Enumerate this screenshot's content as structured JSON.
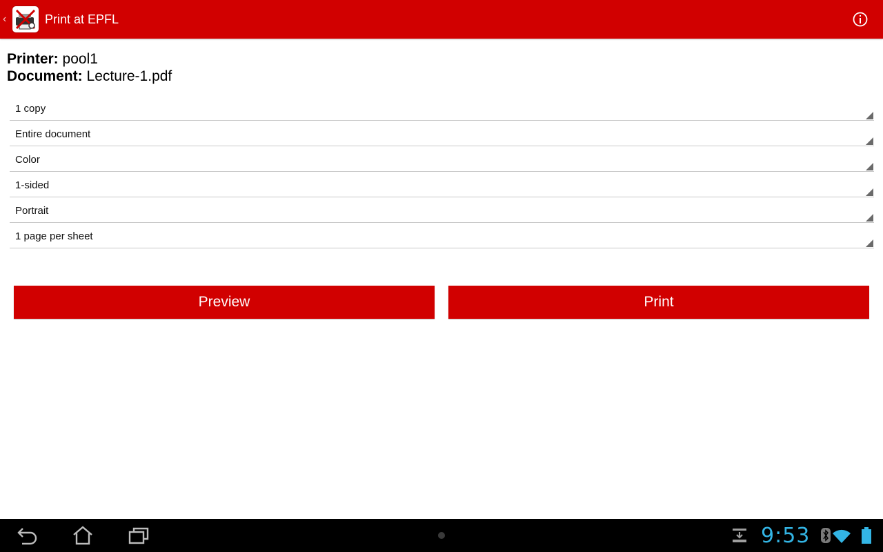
{
  "colors": {
    "brand_red": "#d10000",
    "clock_blue": "#33b5e5"
  },
  "action_bar": {
    "title": "Print at EPFL",
    "up_icon": "chevron-left-icon",
    "app_icon": "print-app-icon",
    "info_icon": "info-icon"
  },
  "info": {
    "printer_label": "Printer:",
    "printer_value": "pool1",
    "document_label": "Document:",
    "document_value": "Lecture-1.pdf"
  },
  "spinners": [
    {
      "value": "1 copy"
    },
    {
      "value": "Entire document"
    },
    {
      "value": "Color"
    },
    {
      "value": "1-sided"
    },
    {
      "value": "Portrait"
    },
    {
      "value": "1 page per sheet"
    }
  ],
  "buttons": {
    "preview_label": "Preview",
    "print_label": "Print"
  },
  "system_bar": {
    "clock": "9:53",
    "icons": [
      "back-icon",
      "home-icon",
      "recent-apps-icon",
      "download-icon",
      "bluetooth-icon",
      "wifi-icon",
      "battery-icon"
    ]
  }
}
